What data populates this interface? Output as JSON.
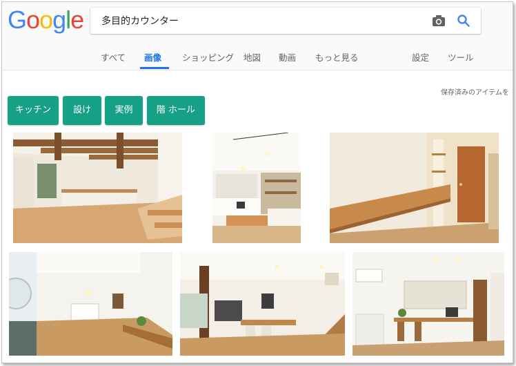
{
  "logo": {
    "letters": [
      "G",
      "o",
      "o",
      "g",
      "l",
      "e"
    ],
    "colors": [
      "#4285F4",
      "#EA4335",
      "#FBBC05",
      "#4285F4",
      "#34A853",
      "#EA4335"
    ]
  },
  "search": {
    "value": "多目的カウンター"
  },
  "tabs": [
    "すべて",
    "画像",
    "ショッピング",
    "地図",
    "動画",
    "もっと見る",
    "設定",
    "ツール"
  ],
  "active_tab": "画像",
  "saved_link": "保存済みのアイテムを",
  "chips": [
    "キッチン",
    "設け",
    "実例",
    "階 ホール"
  ],
  "colors": {
    "accent": "#1a73e8",
    "chip": "#16a085",
    "text_muted": "#5f6368"
  }
}
